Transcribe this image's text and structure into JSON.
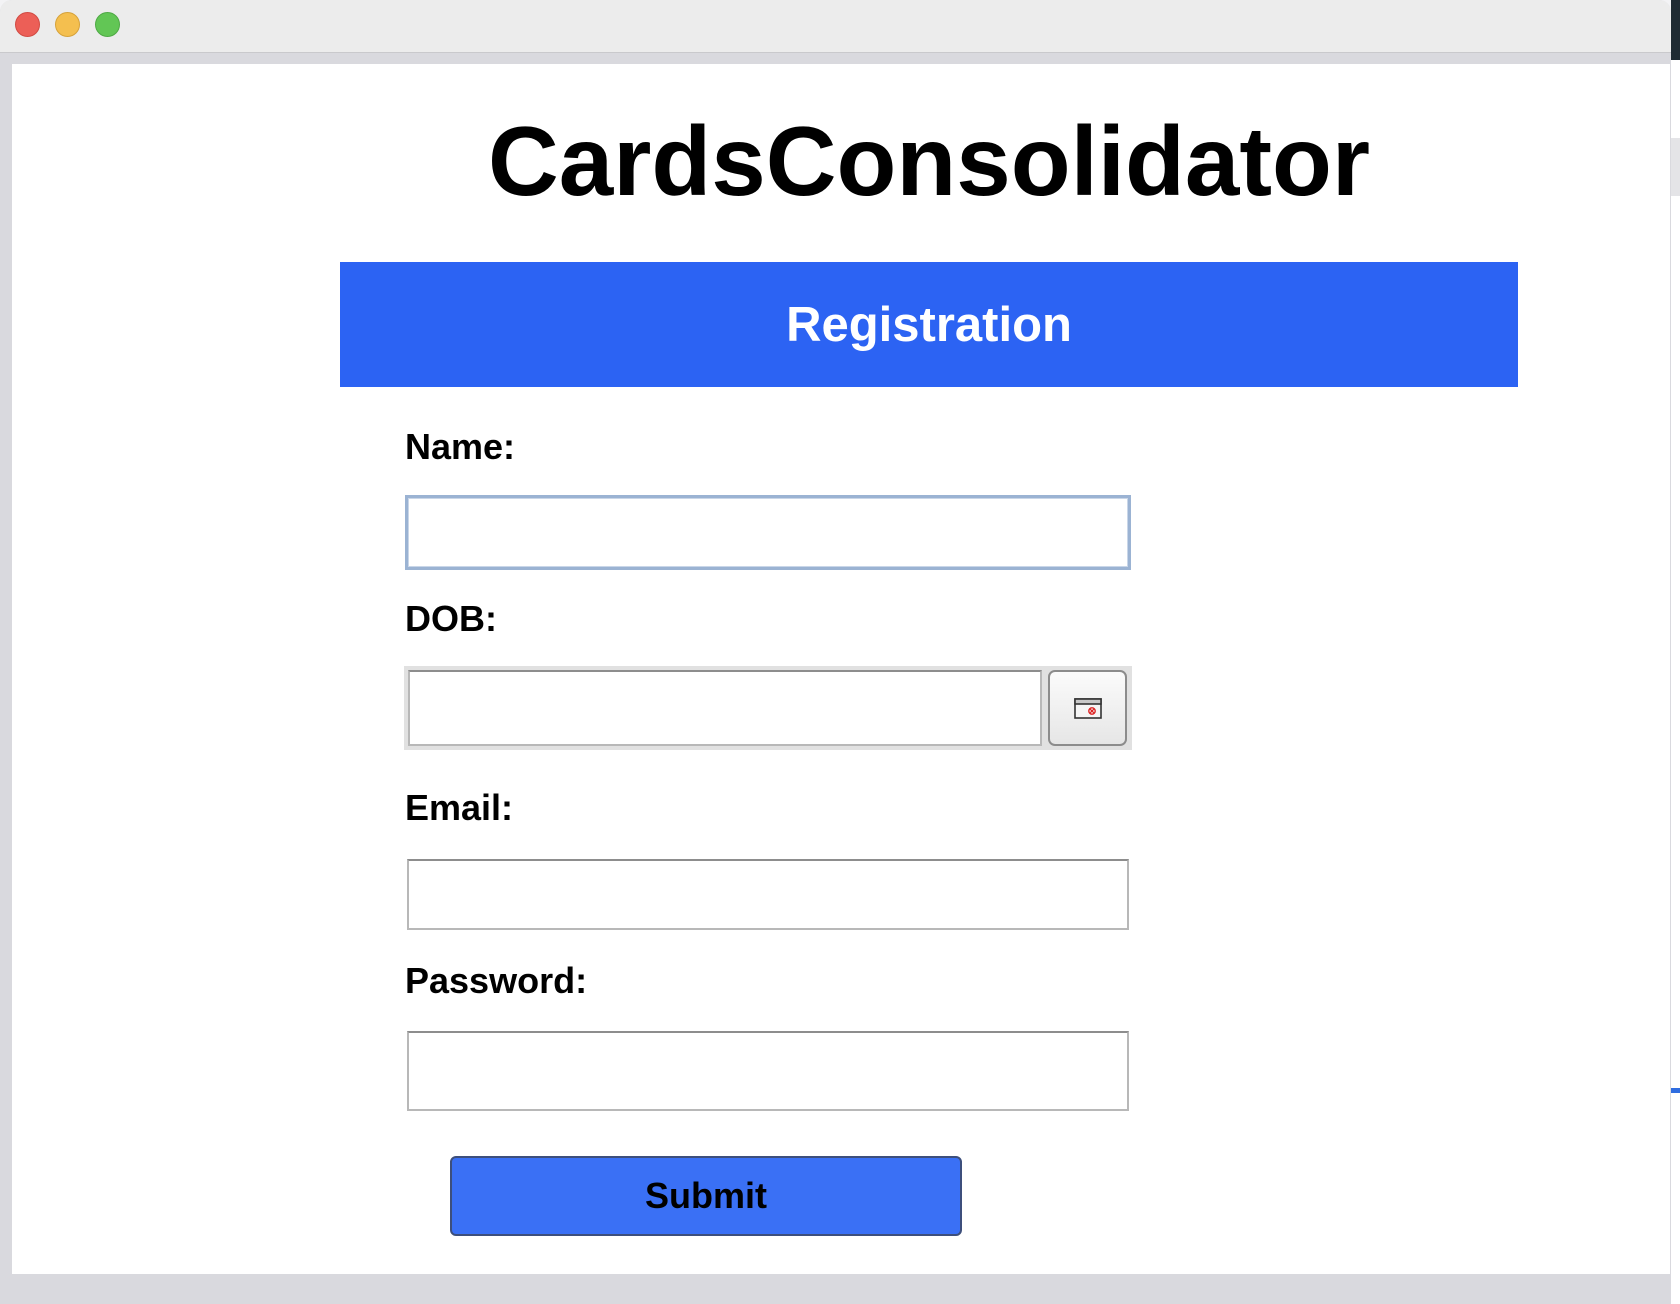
{
  "app": {
    "title": "CardsConsolidator"
  },
  "form": {
    "header": "Registration",
    "name_label": "Name:",
    "name_value": "",
    "dob_label": "DOB:",
    "dob_value": "",
    "email_label": "Email:",
    "email_value": "",
    "password_label": "Password:",
    "password_value": "",
    "submit_label": "Submit"
  },
  "icons": {
    "calendar": "calendar-icon",
    "close": "close-icon",
    "minimize": "minimize-icon",
    "zoom": "zoom-icon"
  },
  "colors": {
    "header_bg": "#2c63f3",
    "submit_bg": "#3a70f5"
  }
}
